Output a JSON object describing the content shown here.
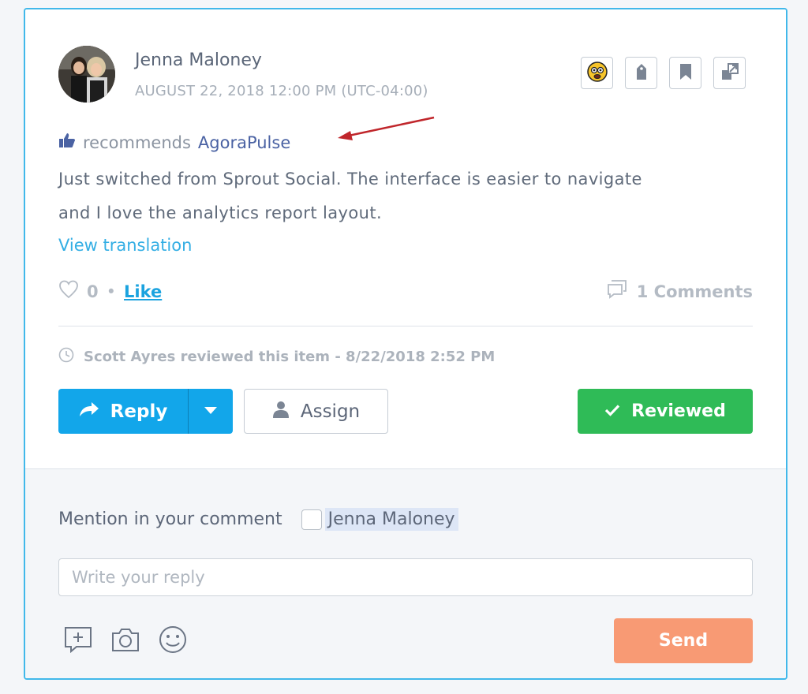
{
  "post": {
    "author": "Jenna Maloney",
    "date": "AUGUST 22, 2018 12:00 PM (UTC-04:00)",
    "recommend_label": "recommends",
    "recommend_page": "AgoraPulse",
    "body_line1": "Just switched from Sprout Social. The interface is easier to navigate",
    "body_line2": "and I love the analytics report layout.",
    "view_translation": "View translation",
    "like_count": "0",
    "like_separator": "•",
    "like_label": "Like",
    "comments": "1 Comments",
    "review_status": "Scott Ayres reviewed this item - 8/22/2018 2:52 PM"
  },
  "toolbar_icons": [
    "sentiment-icon",
    "tag-icon",
    "bookmark-icon",
    "open-external-icon"
  ],
  "buttons": {
    "reply": "Reply",
    "assign": "Assign",
    "reviewed": "Reviewed",
    "send": "Send"
  },
  "composer": {
    "mention_label": "Mention in your comment",
    "mention_name": "Jenna Maloney",
    "placeholder": "Write your reply"
  },
  "colors": {
    "accent_border": "#41b8ea",
    "reply_blue": "#12a6ea",
    "reviewed_green": "#2fbb57",
    "send_orange": "#f89a74",
    "link_blue": "#33aee4",
    "page_link": "#4a62a3"
  }
}
